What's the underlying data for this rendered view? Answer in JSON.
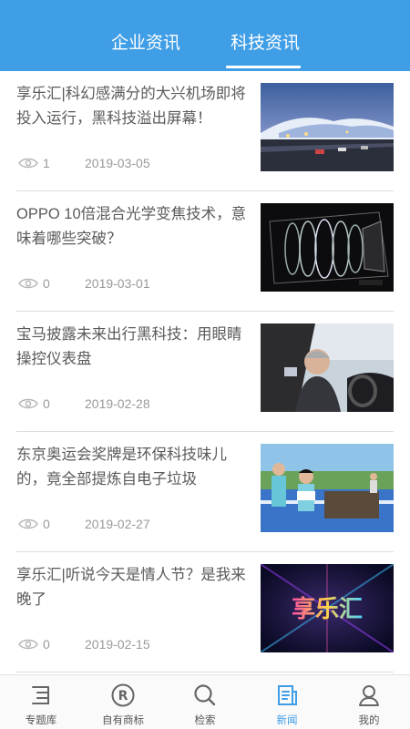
{
  "header": {
    "tabs": [
      {
        "label": "企业资讯",
        "active": false
      },
      {
        "label": "科技资讯",
        "active": true
      }
    ],
    "accent_color": "#3f9ee6"
  },
  "news": [
    {
      "title": "享乐汇|科幻感满分的大兴机场即将投入运行，黑科技溢出屏幕！",
      "views": "1",
      "date": "2019-03-05",
      "thumb": "airport-night-image"
    },
    {
      "title": "OPPO 10倍混合光学变焦技术，意味着哪些突破？",
      "views": "0",
      "date": "2019-03-01",
      "thumb": "camera-lens-image"
    },
    {
      "title": "宝马披露未来出行黑科技：用眼睛操控仪表盘",
      "views": "0",
      "date": "2019-02-28",
      "thumb": "car-driver-image"
    },
    {
      "title": "东京奥运会奖牌是环保科技味儿的，竟全部提炼自电子垃圾",
      "views": "0",
      "date": "2019-02-27",
      "thumb": "kids-recycling-image"
    },
    {
      "title": "享乐汇|听说今天是情人节？是我来晚了",
      "views": "0",
      "date": "2019-02-15",
      "thumb": "xianglehui-logo-image",
      "thumb_text": "享乐汇"
    }
  ],
  "bottom_nav": [
    {
      "label": "专题库",
      "icon": "topic-library-icon",
      "active": false
    },
    {
      "label": "自有商标",
      "icon": "registered-trademark-icon",
      "active": false
    },
    {
      "label": "检索",
      "icon": "search-icon",
      "active": false
    },
    {
      "label": "新闻",
      "icon": "news-icon",
      "active": true
    },
    {
      "label": "我的",
      "icon": "profile-icon",
      "active": false
    }
  ]
}
